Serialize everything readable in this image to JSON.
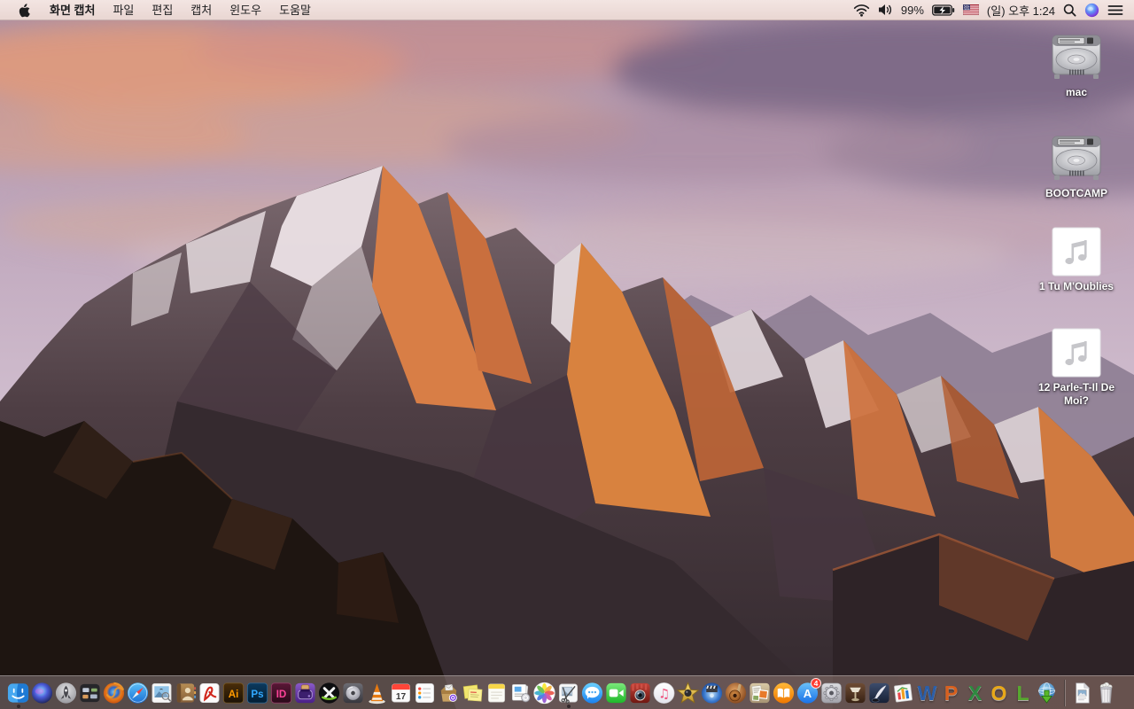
{
  "menu_bar": {
    "app_name": "화면 캡처",
    "menus": [
      "파일",
      "편집",
      "캡처",
      "윈도우",
      "도움말"
    ],
    "status": {
      "battery_percent": "99%",
      "battery_state": "charging",
      "clock": "(일) 오후 1:24",
      "input_source": "us-flag"
    },
    "icons": [
      "apple-logo",
      "wifi",
      "volume",
      "battery-charging",
      "us-flag",
      "spotlight-search",
      "siri",
      "notification-center"
    ],
    "tint": "#efdeda"
  },
  "desktop": {
    "wallpaper": "sierra-mountain-sunset",
    "icons": [
      {
        "name": "hard-drive",
        "label": "mac"
      },
      {
        "name": "hard-drive",
        "label": "BOOTCAMP"
      },
      {
        "name": "audio-file",
        "label": "1 Tu M'Oublies"
      },
      {
        "name": "audio-file",
        "label": "12 Parle-T-Il De Moi?"
      }
    ]
  },
  "dock": {
    "app_store_badge": "4",
    "running_apps": [
      "finder",
      "grab"
    ],
    "badge_color": "#ff3b30",
    "items": [
      {
        "name": "finder",
        "glyph": ""
      },
      {
        "name": "siri",
        "glyph": ""
      },
      {
        "name": "launchpad",
        "glyph": ""
      },
      {
        "name": "mission-control",
        "glyph": ""
      },
      {
        "name": "firefox",
        "glyph": ""
      },
      {
        "name": "safari",
        "glyph": ""
      },
      {
        "name": "preview",
        "glyph": ""
      },
      {
        "name": "contacts",
        "glyph": ""
      },
      {
        "name": "acrobat-reader",
        "glyph": ""
      },
      {
        "name": "illustrator",
        "glyph": "Ai"
      },
      {
        "name": "photoshop",
        "glyph": "Ps"
      },
      {
        "name": "indesign",
        "glyph": "ID"
      },
      {
        "name": "toast",
        "glyph": ""
      },
      {
        "name": "media-converter",
        "glyph": ""
      },
      {
        "name": "disc-utility",
        "glyph": ""
      },
      {
        "name": "vlc",
        "glyph": ""
      },
      {
        "name": "calendar",
        "glyph": "17"
      },
      {
        "name": "reminders",
        "glyph": ""
      },
      {
        "name": "mail-box",
        "glyph": ""
      },
      {
        "name": "stickies",
        "glyph": ""
      },
      {
        "name": "notes",
        "glyph": ""
      },
      {
        "name": "documents-badge",
        "glyph": ""
      },
      {
        "name": "photos",
        "glyph": ""
      },
      {
        "name": "grab",
        "glyph": ""
      },
      {
        "name": "messages",
        "glyph": ""
      },
      {
        "name": "facetime",
        "glyph": ""
      },
      {
        "name": "photo-booth",
        "glyph": ""
      },
      {
        "name": "itunes",
        "glyph": "♫"
      },
      {
        "name": "imovie-star",
        "glyph": ""
      },
      {
        "name": "dvd-app",
        "glyph": ""
      },
      {
        "name": "garageband",
        "glyph": ""
      },
      {
        "name": "collage-app",
        "glyph": ""
      },
      {
        "name": "ibooks",
        "glyph": ""
      },
      {
        "name": "app-store",
        "glyph": "A"
      },
      {
        "name": "system-preferences",
        "glyph": ""
      },
      {
        "name": "keynote",
        "glyph": ""
      },
      {
        "name": "writing-app",
        "glyph": ""
      },
      {
        "name": "office-launcher",
        "glyph": ""
      },
      {
        "name": "word",
        "glyph": "W"
      },
      {
        "name": "powerpoint",
        "glyph": "P"
      },
      {
        "name": "excel",
        "glyph": "X"
      },
      {
        "name": "outlook",
        "glyph": "O"
      },
      {
        "name": "lync",
        "glyph": "L"
      },
      {
        "name": "ms-autoupdate",
        "glyph": ""
      },
      {
        "name": "document-file",
        "glyph": ""
      },
      {
        "name": "trash-full",
        "glyph": ""
      }
    ]
  }
}
